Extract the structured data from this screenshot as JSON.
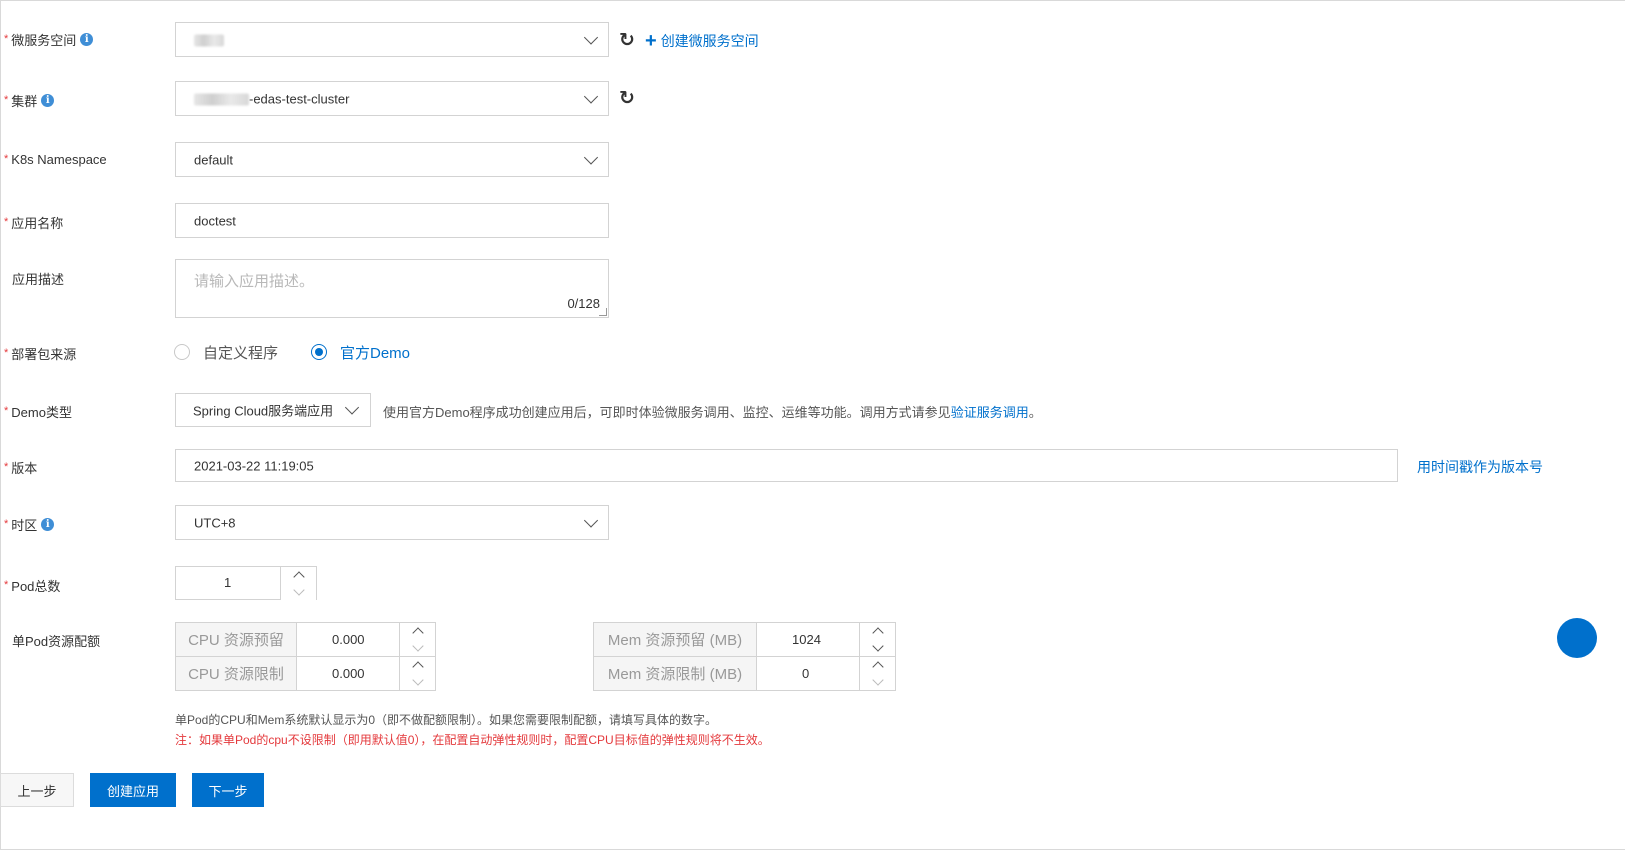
{
  "form": {
    "namespace": {
      "label": "微服务空间",
      "value": "",
      "create_link": "创建微服务空间"
    },
    "cluster": {
      "label": "集群",
      "value": "-edas-test-cluster"
    },
    "k8s_namespace": {
      "label": "K8s Namespace",
      "value": "default"
    },
    "app_name": {
      "label": "应用名称",
      "value": "doctest"
    },
    "app_desc": {
      "label": "应用描述",
      "placeholder": "请输入应用描述。",
      "counter": "0/128"
    },
    "package_source": {
      "label": "部署包来源",
      "options": [
        "自定义程序",
        "官方Demo"
      ],
      "selected": "官方Demo"
    },
    "demo_type": {
      "label": "Demo类型",
      "value": "Spring Cloud服务端应用",
      "hint": "使用官方Demo程序成功创建应用后，可即时体验微服务调用、监控、运维等功能。调用方式请参见",
      "hint_link": "验证服务调用",
      "hint_end": "。"
    },
    "version": {
      "label": "版本",
      "value": "2021-03-22 11:19:05",
      "timestamp_link": "用时间戳作为版本号"
    },
    "timezone": {
      "label": "时区",
      "value": "UTC+8"
    },
    "pod_count": {
      "label": "Pod总数",
      "value": "1"
    },
    "pod_resources": {
      "label": "单Pod资源配额",
      "cpu_reserve_label": "CPU 资源预留",
      "cpu_reserve_value": "0.000",
      "cpu_limit_label": "CPU 资源限制",
      "cpu_limit_value": "0.000",
      "mem_reserve_label": "Mem 资源预留 (MB)",
      "mem_reserve_value": "1024",
      "mem_limit_label": "Mem 资源限制 (MB)",
      "mem_limit_value": "0"
    },
    "note": "单Pod的CPU和Mem系统默认显示为0（即不做配额限制）。如果您需要限制配额，请填写具体的数字。",
    "warning": "注：如果单Pod的cpu不设限制（即用默认值0），在配置自动弹性规则时，配置CPU目标值的弹性规则将不生效。"
  },
  "buttons": {
    "prev": "上一步",
    "create": "创建应用",
    "next": "下一步"
  },
  "colors": {
    "primary": "#0070cc",
    "required": "#e4393c",
    "warning": "#e4393c",
    "border": "#d3d3d3"
  }
}
